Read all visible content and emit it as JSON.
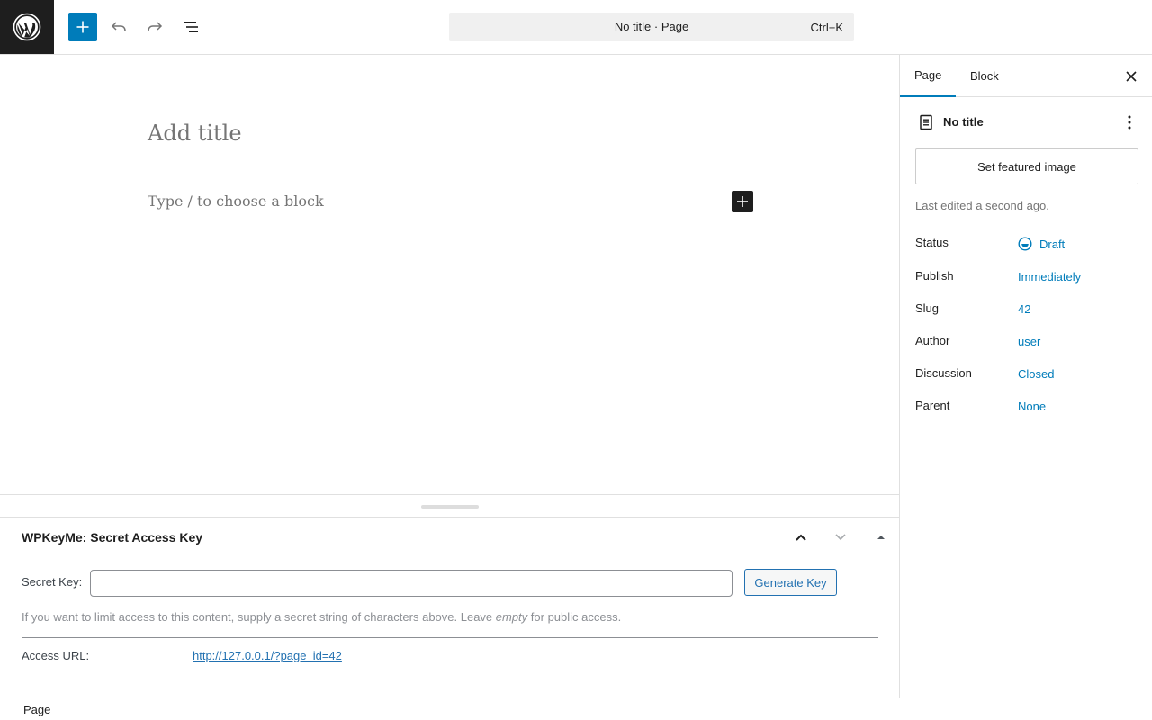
{
  "topbar": {
    "command_title": "No title · Page",
    "command_shortcut": "Ctrl+K"
  },
  "canvas": {
    "title_placeholder": "Add title",
    "block_placeholder": "Type / to choose a block"
  },
  "metabox": {
    "title": "WPKeyMe: Secret Access Key",
    "secret_label": "Secret Key:",
    "secret_value": "",
    "generate_label": "Generate Key",
    "help_before": "If you want to limit access to this content, supply a secret string of characters above. Leave ",
    "help_em": "empty",
    "help_after": " for public access.",
    "access_label": "Access URL:",
    "access_url": "http://127.0.0.1/?page_id=42"
  },
  "footer": {
    "breadcrumb": "Page"
  },
  "sidebar": {
    "tabs": [
      {
        "label": "Page",
        "active": true
      },
      {
        "label": "Block",
        "active": false
      }
    ],
    "doc_title": "No title",
    "featured_image_label": "Set featured image",
    "last_edited": "Last edited a second ago.",
    "properties": [
      {
        "label": "Status",
        "value": "Draft"
      },
      {
        "label": "Publish",
        "value": "Immediately"
      },
      {
        "label": "Slug",
        "value": "42"
      },
      {
        "label": "Author",
        "value": "user"
      },
      {
        "label": "Discussion",
        "value": "Closed"
      },
      {
        "label": "Parent",
        "value": "None"
      }
    ]
  },
  "colors": {
    "accent": "#007cba",
    "dark": "#1e1e1e",
    "link": "#2271b1"
  },
  "icons": [
    "wordpress-logo-icon",
    "plus-icon",
    "undo-icon",
    "redo-icon",
    "list-view-icon",
    "close-icon",
    "page-icon",
    "more-vertical-icon",
    "chevron-up-icon",
    "chevron-down-icon",
    "caret-up-icon",
    "draft-status-icon"
  ]
}
